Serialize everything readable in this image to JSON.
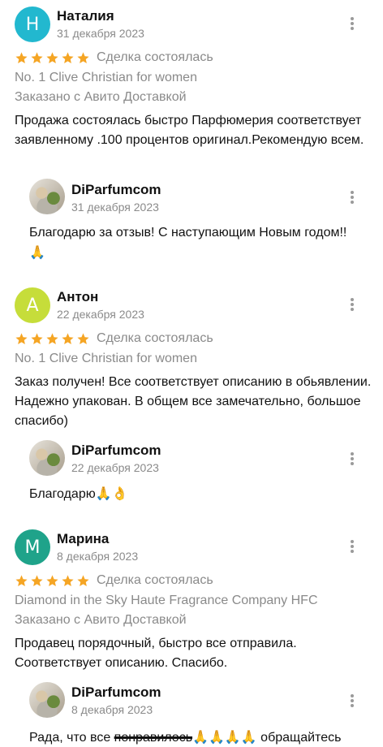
{
  "reviews": [
    {
      "initial": "Н",
      "avatar_color": "#22b8cf",
      "name": "Наталия",
      "date": "31 декабря 2023",
      "deal": "Сделка состоялась",
      "product": "No. 1 Clive Christian for women",
      "delivery": "Заказано с Авито Доставкой",
      "text": "Продажа состоялась быстро Парфюмерия соответствует заявленному .100 процентов оригинал.Рекомендую всем.",
      "reply": {
        "name": "DiParfumcom",
        "date": "31 декабря 2023",
        "text": "Благодарю за отзыв! С наступающим Новым годом!!",
        "emoji": "🙏"
      }
    },
    {
      "initial": "А",
      "avatar_color": "#c6dd3a",
      "name": "Антон",
      "date": "22 декабря 2023",
      "deal": "Сделка состоялась",
      "product": "No. 1 Clive Christian for women",
      "text": "Заказ получен! Все соответствует описанию в обьявлении. Надежно упакован. В общем все замечательно, большое спасибо)",
      "reply": {
        "name": "DiParfumcom",
        "date": "22 декабря 2023",
        "text": "Благодарю",
        "emoji": "🙏👌"
      }
    },
    {
      "initial": "М",
      "avatar_color": "#1fa38a",
      "name": "Марина",
      "date": "8 декабря 2023",
      "deal": "Сделка состоялась",
      "product": "Diamond in the Sky Haute Fragrance Company HFC",
      "delivery": "Заказано с Авито Доставкой",
      "text": "Продавец порядочный, быстро все отправила. Соответствует описанию. Спасибо.",
      "reply": {
        "name": "DiParfumcom",
        "date": "8 декабря 2023",
        "text_start": "Рада, что все ",
        "text_struck": "понравилось",
        "emoji": "🙏🙏🙏🙏",
        "text_end": " обращайтесь"
      }
    }
  ],
  "rating_stars": 5,
  "star_color": "#f5a524",
  "icons": [
    "star-icon",
    "more-vertical-icon"
  ]
}
